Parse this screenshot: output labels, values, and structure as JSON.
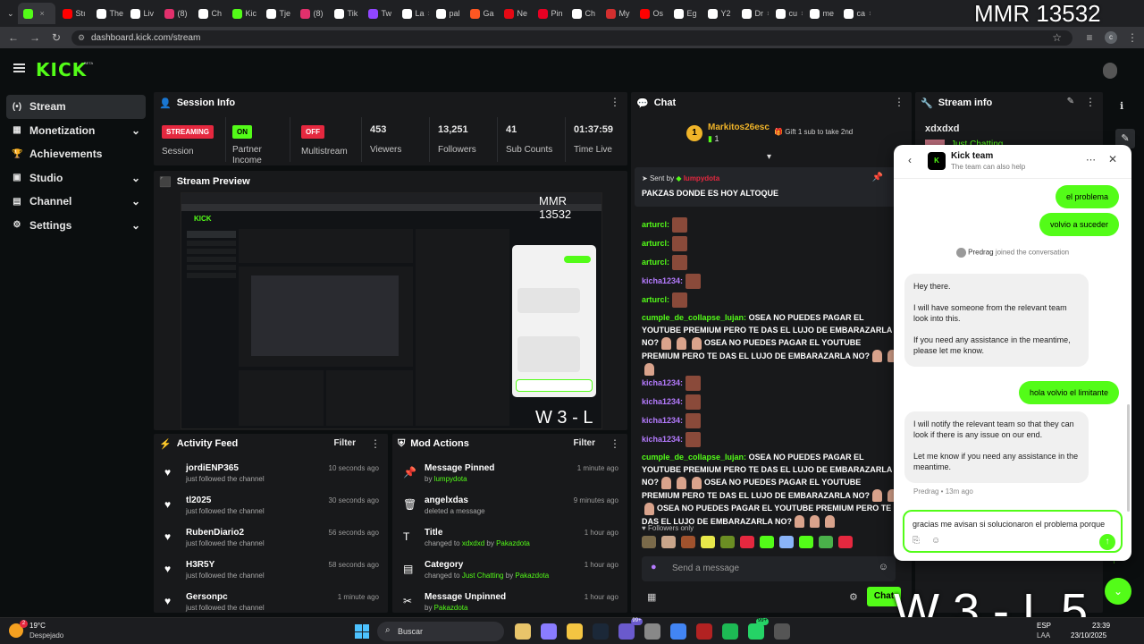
{
  "overlay": {
    "top_right": "MMR 13532",
    "bottom_right": "W 3 - L 5",
    "preview_top": "MMR 13532",
    "preview_bottom": "W 3 - L 5"
  },
  "browser": {
    "tabs": [
      {
        "label": "",
        "color": "#53fc18",
        "active": true
      },
      {
        "label": "Stı",
        "color": "#ff0000"
      },
      {
        "label": "The",
        "color": "#ffffff"
      },
      {
        "label": "Liv",
        "color": "#ffffff"
      },
      {
        "label": "(8)",
        "color": "#e1306c"
      },
      {
        "label": "Ch",
        "color": "#ffffff"
      },
      {
        "label": "Kic",
        "color": "#53fc18"
      },
      {
        "label": "Tje",
        "color": "#ffffff"
      },
      {
        "label": "(8)",
        "color": "#e1306c"
      },
      {
        "label": "Tik",
        "color": "#ffffff"
      },
      {
        "label": "Tw",
        "color": "#9146ff"
      },
      {
        "label": "La",
        "color": "#ffffff"
      },
      {
        "label": "pal",
        "color": "#ffffff"
      },
      {
        "label": "Ga",
        "color": "#ff5722"
      },
      {
        "label": "Ne",
        "color": "#e50914"
      },
      {
        "label": "Pin",
        "color": "#e60023"
      },
      {
        "label": "Ch",
        "color": "#ffffff"
      },
      {
        "label": "My",
        "color": "#d32f2f"
      },
      {
        "label": "Os",
        "color": "#ff0000"
      },
      {
        "label": "Eg",
        "color": "#ffffff"
      },
      {
        "label": "Y2",
        "color": "#ffffff"
      },
      {
        "label": "Dr",
        "color": "#ffffff"
      },
      {
        "label": "cu",
        "color": "#ffffff"
      },
      {
        "label": "me",
        "color": "#ffffff"
      },
      {
        "label": "ca",
        "color": "#ffffff"
      }
    ],
    "url": "dashboard.kick.com/stream"
  },
  "kick": {
    "logo": "KICK",
    "beta": "BETA"
  },
  "sidebar": {
    "items": [
      {
        "label": "Stream",
        "icon": "(•)"
      },
      {
        "label": "Monetization",
        "icon": "▦"
      },
      {
        "label": "Achievements",
        "icon": "🏆"
      },
      {
        "label": "Studio",
        "icon": "▣"
      },
      {
        "label": "Channel",
        "icon": "▤"
      },
      {
        "label": "Settings",
        "icon": "⚙"
      }
    ]
  },
  "session": {
    "title": "Session Info",
    "streaming_badge": "STREAMING",
    "streaming_label": "Session",
    "partner_badge": "ON",
    "partner_label": "Partner Income",
    "multistream_badge": "OFF",
    "multistream_label": "Multistream",
    "viewers": "453",
    "viewers_label": "Viewers",
    "followers": "13,251",
    "followers_label": "Followers",
    "subs": "41",
    "subs_label": "Sub Counts",
    "time": "01:37:59",
    "time_label": "Time Live"
  },
  "preview": {
    "title": "Stream Preview"
  },
  "activity": {
    "title": "Activity Feed",
    "filter": "Filter",
    "rows": [
      {
        "name": "jordiENP365",
        "sub": "just followed the channel",
        "time": "10 seconds ago"
      },
      {
        "name": "tl2025",
        "sub": "just followed the channel",
        "time": "30 seconds ago"
      },
      {
        "name": "RubenDiario2",
        "sub": "just followed the channel",
        "time": "56 seconds ago"
      },
      {
        "name": "H3R5Y",
        "sub": "just followed the channel",
        "time": "58 seconds ago"
      },
      {
        "name": "Gersonpc",
        "sub": "just followed the channel",
        "time": "1 minute ago"
      }
    ]
  },
  "mod": {
    "title": "Mod Actions",
    "filter": "Filter",
    "rows": [
      {
        "name": "Message Pinned",
        "pre": "by ",
        "hl": "lumpydota",
        "time": "1 minute ago"
      },
      {
        "name": "angelxdas",
        "pre": "deleted a message",
        "hl": "",
        "time": "9 minutes ago"
      },
      {
        "name": "Title",
        "pre": "changed to ",
        "hl": "xdxdxd",
        "mid": " by ",
        "hl2": "Pakazdota",
        "time": "1 hour ago"
      },
      {
        "name": "Category",
        "pre": "changed to ",
        "hl": "Just Chatting",
        "mid": " by ",
        "hl2": "Pakazdota",
        "time": "1 hour ago"
      },
      {
        "name": "Message Unpinned",
        "pre": "by ",
        "hl": "Pakazdota",
        "time": "1 hour ago"
      }
    ]
  },
  "chat": {
    "title": "Chat",
    "gifter_name": "Markitos26esc",
    "gifter_count": "1",
    "gift_cta": "Gift 1 sub to take 2nd",
    "pinned_by_label": "Sent by",
    "pinned_user": "lumpydota",
    "pinned_msg": "PAKZAS DONDE ES HOY ALTOQUE",
    "lines": [
      {
        "user": "arturcl:",
        "color": "#53fc18",
        "text": "",
        "emotes": 1
      },
      {
        "user": "arturcl:",
        "color": "#53fc18",
        "text": "",
        "emotes": 1
      },
      {
        "user": "arturcl:",
        "color": "#53fc18",
        "text": "",
        "emotes": 1
      },
      {
        "user": "kicha1234:",
        "color": "#b57bff",
        "text": "",
        "emotes": 1
      },
      {
        "user": "arturcl:",
        "color": "#53fc18",
        "text": "",
        "emotes": 1
      }
    ],
    "long1_user": "cumple_de_collapse_lujan:",
    "long1_text": "OSEA NO PUEDES PAGAR EL YOUTUBE PREMIUM PERO TE DAS EL LUJO DE EMBARAZARLA NO?",
    "long1_text2": "OSEA NO PUEDES PAGAR EL YOUTUBE PREMIUM PERO TE DAS EL LUJO DE EMBARAZARLA NO?",
    "kicha_lines": [
      "kicha1234:",
      "kicha1234:",
      "kicha1234:",
      "kicha1234:"
    ],
    "long2_user": "cumple_de_collapse_lujan:",
    "long2_text": "OSEA NO PUEDES PAGAR EL YOUTUBE PREMIUM PERO TE DAS EL LUJO DE EMBARAZARLA NO?",
    "long2_text2": "OSEA NO PUEDES PAGAR EL YOUTUBE PREMIUM PERO TE DAS EL LUJO DE EMBARAZARLA NO?",
    "long2_text3": "OSEA NO PUEDES PAGAR EL YOUTUBE PREMIUM PERO TE DAS EL LUJO DE EMBARAZARLA NO?",
    "followers_only": "Followers only",
    "placeholder": "Send a message",
    "send_label": "Chat"
  },
  "streaminfo": {
    "title": "Stream info",
    "stream_title": "xdxdxd",
    "category": "Just Chatting"
  },
  "support": {
    "title": "Kick team",
    "subtitle": "The team can also help",
    "user_msgs": [
      "el problema",
      "volvio a suceder"
    ],
    "joined_name": "Predrag",
    "joined_text": " joined the conversation",
    "agent_msg1_a": "Hey there.",
    "agent_msg1_b": "I will have someone from the relevant team look into this.",
    "agent_msg1_c": "If you need any assistance in the meantime, please let me know.",
    "user_msg3": "hola volvio el limitante",
    "agent_msg2_a": "I will notify the relevant team so that they can look if there is any issue on our end.",
    "agent_msg2_b": "Let me know if you need any assistance in the meantime.",
    "agent_meta": "Predrag • 13m ago",
    "input_value": "gracias me avisan si solucionaron el problema porque"
  },
  "taskbar": {
    "temp": "19°C",
    "weather": "Despejado",
    "search": "Buscar",
    "lang1": "ESP",
    "lang2": "LAA",
    "time": "23:39",
    "date": "23/10/2025",
    "badge_teams": "99+",
    "badge_wa": "99+",
    "weather_count": "2"
  }
}
